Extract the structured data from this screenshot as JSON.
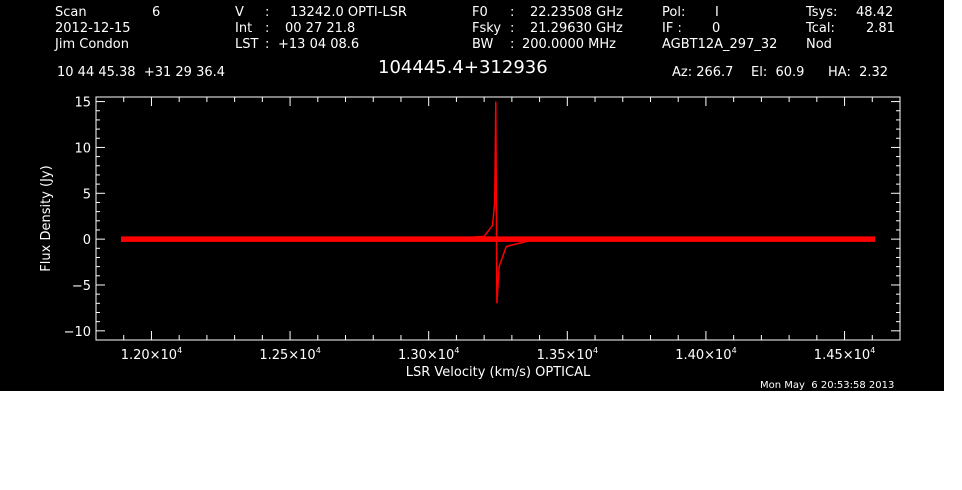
{
  "header": {
    "scan_label": "Scan",
    "scan_value": "6",
    "date": "2012-12-15",
    "observer": "Jim Condon",
    "v_label": "V",
    "v_sep": ":",
    "v_value": "13242.0 OPTI-LSR",
    "int_label": "Int",
    "int_sep": ":",
    "int_value": "00 27 21.8",
    "lst_label": "LST",
    "lst_sep": ":",
    "lst_value": "+13 04 08.6",
    "f0_label": "F0",
    "f0_sep": ":",
    "f0_value": "22.23508 GHz",
    "fsky_label": "Fsky",
    "fsky_sep": ":",
    "fsky_value": "21.29630 GHz",
    "bw_label": "BW",
    "bw_sep": ":",
    "bw_value": "200.0000 MHz",
    "pol_label": "Pol:",
    "pol_value": "I",
    "if_label": "IF :",
    "if_value": "0",
    "project": "AGBT12A_297_32",
    "tsys_label": "Tsys:",
    "tsys_value": "48.42",
    "tcal_label": "Tcal:",
    "tcal_value": "2.81",
    "proc": "Nod",
    "coords": "10 44 45.38  +31 29 36.4",
    "source": "104445.4+312936",
    "az": "Az: 266.7",
    "el": "El:  60.9",
    "ha": "HA:  2.32"
  },
  "footer": {
    "timestamp": "Mon May  6 20:53:58 2013"
  },
  "colors": {
    "trace": "#ff0000",
    "axes": "#ffffff",
    "background": "#000000"
  },
  "chart_data": {
    "type": "line",
    "xlabel": "LSR Velocity (km/s) OPTICAL",
    "ylabel": "Flux Density (Jy)",
    "xlim": [
      11800,
      14700
    ],
    "ylim": [
      -11,
      15.5
    ],
    "x_ticks": [
      {
        "value": 12000,
        "mantissa": "1.20",
        "exp": "4"
      },
      {
        "value": 12500,
        "mantissa": "1.25",
        "exp": "4"
      },
      {
        "value": 13000,
        "mantissa": "1.30",
        "exp": "4"
      },
      {
        "value": 13500,
        "mantissa": "1.35",
        "exp": "4"
      },
      {
        "value": 14000,
        "mantissa": "1.40",
        "exp": "4"
      },
      {
        "value": 14500,
        "mantissa": "1.45",
        "exp": "4"
      }
    ],
    "y_ticks": [
      {
        "value": 15,
        "label": "15"
      },
      {
        "value": 10,
        "label": "10"
      },
      {
        "value": 5,
        "label": "5"
      },
      {
        "value": 0,
        "label": "0"
      },
      {
        "value": -5,
        "label": "−5"
      },
      {
        "value": -10,
        "label": "−10"
      }
    ],
    "series": [
      {
        "x": [
          11890,
          12200,
          12500,
          12800,
          13100,
          13200,
          13230,
          13238,
          13242,
          13246,
          13254,
          13280,
          13400,
          13700,
          14000,
          14300,
          14610
        ],
        "y": [
          0,
          0.1,
          0.1,
          0,
          0.1,
          0.3,
          1.5,
          4.0,
          15.0,
          -7.0,
          -3.0,
          -0.8,
          0.1,
          0,
          0.1,
          0,
          0
        ],
        "noise_jy": 0.3
      }
    ]
  }
}
